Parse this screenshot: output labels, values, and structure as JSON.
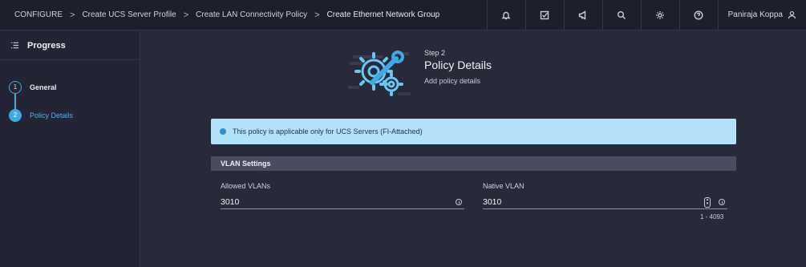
{
  "breadcrumb": {
    "items": [
      "CONFIGURE",
      "Create UCS Server Profile",
      "Create LAN Connectivity Policy",
      "Create Ethernet Network Group"
    ],
    "separator": ">"
  },
  "header": {
    "icons": [
      "bell-icon",
      "task-check-icon",
      "megaphone-icon",
      "search-icon",
      "gear-icon",
      "help-icon"
    ],
    "user_name": "Paniraja Koppa"
  },
  "sidebar": {
    "title": "Progress",
    "steps": [
      {
        "number": "1",
        "label": "General",
        "active": false
      },
      {
        "number": "2",
        "label": "Policy Details",
        "active": true
      }
    ]
  },
  "main": {
    "step_tag": "Step 2",
    "title": "Policy Details",
    "subtitle": "Add policy details",
    "banner": "This policy is applicable only for UCS Servers (FI-Attached)",
    "section_title": "VLAN Settings",
    "allowed_vlans": {
      "label": "Allowed VLANs",
      "value": "3010"
    },
    "native_vlan": {
      "label": "Native VLAN",
      "value": "3010",
      "range": "1 - 4093"
    }
  },
  "colors": {
    "background": "#282a3a",
    "topbar": "#1d1f2c",
    "accent": "#3fa9e6",
    "banner": "#b3e2f8",
    "section": "#4a4d61"
  }
}
